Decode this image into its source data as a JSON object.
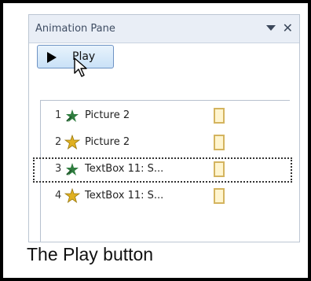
{
  "pane": {
    "title": "Animation Pane",
    "dropdown_icon": "chevron-down-icon",
    "close_icon": "close-icon",
    "close_glyph": "✕"
  },
  "toolbar": {
    "play_label": "Play",
    "play_icon": "play-icon"
  },
  "animation_list": {
    "items": [
      {
        "number": "1",
        "label": "Picture 2",
        "effect_icon": "entrance-effect-icon",
        "selected": false
      },
      {
        "number": "2",
        "label": "Picture 2",
        "effect_icon": "emphasis-effect-icon",
        "selected": false
      },
      {
        "number": "3",
        "label": "TextBox 11: S...",
        "effect_icon": "entrance-effect-icon",
        "selected": true
      },
      {
        "number": "4",
        "label": "TextBox 11: S...",
        "effect_icon": "emphasis-effect-icon",
        "selected": false
      }
    ]
  },
  "caption": {
    "text": "The Play button"
  },
  "colors": {
    "header_bg": "#e9eef6",
    "play_button_border": "#6e93c4",
    "timing_bar_border": "#d4b45f",
    "timing_bar_fill": "#fff5cf",
    "entrance_icon": "#2f7d3f",
    "emphasis_icon": "#e0b020"
  }
}
